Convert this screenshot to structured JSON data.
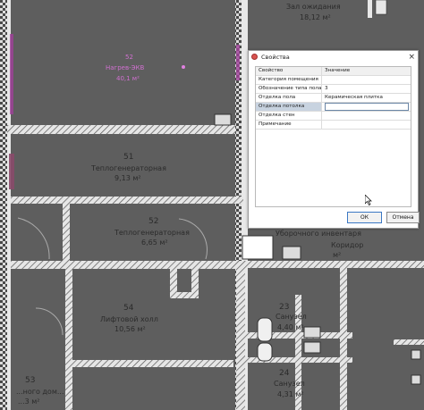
{
  "plan": {
    "rooms": [
      {
        "num": "",
        "name": "Зал ожидания",
        "area": "18,12 м²"
      },
      {
        "num": "52",
        "name": "Нагрев-ЭКВ",
        "area": "40,1 м²"
      },
      {
        "num": "51",
        "name": "Теплогенераторная",
        "area": "9,13 м²"
      },
      {
        "num": "52",
        "name": "Теплогенераторная",
        "area": "6,65 м²"
      },
      {
        "num": "54",
        "name": "Лифтовой холл",
        "area": "10,56 м²"
      },
      {
        "num": "",
        "name": "Уборочного инвентаря",
        "area": ""
      },
      {
        "num": "",
        "name": "Коридор",
        "area": "м²"
      },
      {
        "num": "23",
        "name": "Санузел",
        "area": "4,40 м²"
      },
      {
        "num": "24",
        "name": "Санузел",
        "area": "4,31 м²"
      },
      {
        "num": "53",
        "name": "...ного дом...",
        "area": "...3 м²"
      }
    ]
  },
  "dialog": {
    "title": "Свойства",
    "close_glyph": "×",
    "columns": {
      "property": "Свойство",
      "value": "Значение"
    },
    "rows": [
      {
        "key": "Категория помещения",
        "value": ""
      },
      {
        "key": "Обозначение типа пола",
        "value": "3"
      },
      {
        "key": "Отделка пола",
        "value": "Керамическая плитка"
      },
      {
        "key": "Отделка потолка",
        "value": ""
      },
      {
        "key": "Отделка стен",
        "value": ""
      },
      {
        "key": "Примечание",
        "value": ""
      }
    ],
    "selected_row_index": 3,
    "ok_label": "ОК",
    "cancel_label": "Отмена"
  },
  "colors": {
    "background": "#5e5e5e",
    "walls": "#e8e8e8",
    "highlight": "#d070d0",
    "selection": "#c8d3e0"
  }
}
